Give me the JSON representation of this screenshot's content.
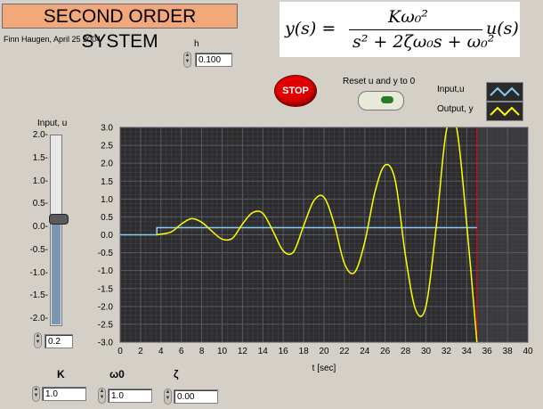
{
  "title": "SECOND ORDER SYSTEM",
  "author_line": "Finn Haugen, April 25 2004",
  "equation": {
    "lhs": "y(s) =",
    "numerator": "Kω₀²",
    "denominator": "s² + 2ζω₀s + ω₀²",
    "rhs": "u(s)"
  },
  "h_control": {
    "label": "h",
    "value": "0.100"
  },
  "stop_button": {
    "label": "STOP"
  },
  "reset_button": {
    "label": "Reset u and y to 0"
  },
  "legend": [
    {
      "name": "Input,u",
      "color": "#87cefa"
    },
    {
      "name": "Output, y",
      "color": "#ffff00"
    }
  ],
  "input_slider": {
    "label": "Input, u",
    "ticks": [
      "2.0-",
      "1.5-",
      "1.0-",
      "0.5-",
      "0.0-",
      "-0.5-",
      "-1.0-",
      "-1.5-",
      "-2.0-"
    ],
    "value": 0.2,
    "value_text": "0.2"
  },
  "params": {
    "K": {
      "label": "K",
      "value": "1.0"
    },
    "w0": {
      "label": "ω0",
      "value": "1.0"
    },
    "zeta": {
      "label": "ζ",
      "value": "0.00"
    }
  },
  "colors": {
    "panel": "#d4d0c8",
    "plot_bg": "#2d2d2d",
    "grid": "#5a5a6a",
    "input": "#87cefa",
    "output": "#ffff00",
    "cursor": "#ff0000"
  },
  "chart_data": {
    "type": "line",
    "xlabel": "t [sec]",
    "ylabel": "",
    "xlim": [
      0,
      40
    ],
    "ylim": [
      -3.0,
      3.0
    ],
    "x_ticks": [
      "0",
      "2",
      "4",
      "6",
      "8",
      "10",
      "12",
      "14",
      "16",
      "18",
      "20",
      "22",
      "24",
      "26",
      "28",
      "30",
      "32",
      "34",
      "36",
      "38",
      "40"
    ],
    "y_ticks": [
      "3.0",
      "2.5",
      "2.0",
      "1.5",
      "1.0",
      "0.5",
      "0.0",
      "-0.5",
      "-1.0",
      "-1.5",
      "-2.0",
      "-2.5",
      "-3.0"
    ],
    "grid": true,
    "cursor_x": 35,
    "series": [
      {
        "name": "Input,u",
        "step_time": 3.6,
        "step_value": 0.2,
        "x": [
          0,
          3.6,
          3.6,
          35
        ],
        "values": [
          0,
          0,
          0.2,
          0.2
        ]
      },
      {
        "name": "Output, y",
        "x": [
          3.6,
          5,
          6,
          7,
          8,
          9,
          10,
          11,
          12,
          13,
          14,
          15,
          16,
          17,
          18,
          19,
          20,
          21,
          22,
          23,
          24,
          25,
          26,
          27,
          28,
          29,
          30,
          31,
          32,
          33,
          34,
          35
        ],
        "values": [
          0,
          0.08,
          0.3,
          0.45,
          0.35,
          0.1,
          -0.12,
          -0.1,
          0.3,
          0.62,
          0.6,
          0.1,
          -0.45,
          -0.48,
          0.25,
          0.95,
          1.05,
          0.3,
          -0.8,
          -1.05,
          -0.2,
          1.2,
          1.95,
          1.5,
          -0.6,
          -2.1,
          -2.0,
          0.2,
          2.9,
          3.0,
          0.3,
          -3.0
        ]
      }
    ]
  }
}
